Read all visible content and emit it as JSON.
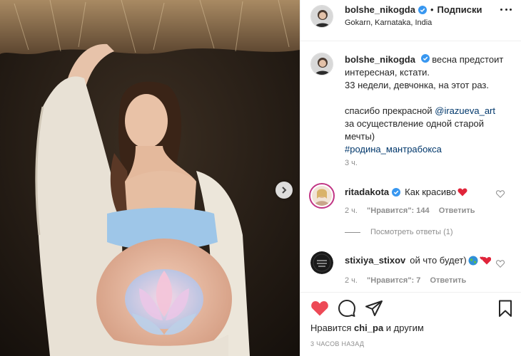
{
  "header": {
    "username": "bolshe_nikogda",
    "separator": "•",
    "follow_label": "Подписки",
    "location": "Gokarn, Karnataka, India"
  },
  "caption": {
    "username": "bolshe_nikogda",
    "text_line1": "весна предстоит",
    "line2": "интересная, кстати.",
    "line3": "33 недели, девчонка, на этот раз.",
    "line5_prefix": "спасибо прекрасной ",
    "mention": "@irazueva_art",
    "line6": "за осуществление одной старой",
    "line7": "мечты)",
    "hashtag": "#родина_мантрабокса",
    "time": "3 ч."
  },
  "comments": [
    {
      "username": "ritadakota",
      "text": "Как красиво",
      "time": "2 ч.",
      "likes": "\"Нравится\": 144",
      "reply_label": "Ответить",
      "view_replies": "Посмотреть ответы (1)"
    },
    {
      "username": "stixiya_stixov",
      "text": "ой что будет)",
      "time": "2 ч.",
      "likes": "\"Нравится\": 7",
      "reply_label": "Ответить"
    }
  ],
  "footer": {
    "likes_prefix": "Нравится ",
    "likes_user": "chi_pa",
    "likes_suffix": " и другим",
    "time_ago": "3 часов назад"
  },
  "colors": {
    "liked_heart": "#ed4956",
    "verified": "#3897f0",
    "link": "#00376b",
    "muted": "#8e8e8e"
  },
  "icons": [
    "verified-badge-icon",
    "more-options-icon",
    "chevron-right-icon",
    "heart-filled-icon",
    "comment-icon",
    "share-icon",
    "bookmark-icon",
    "heart-outline-icon"
  ]
}
